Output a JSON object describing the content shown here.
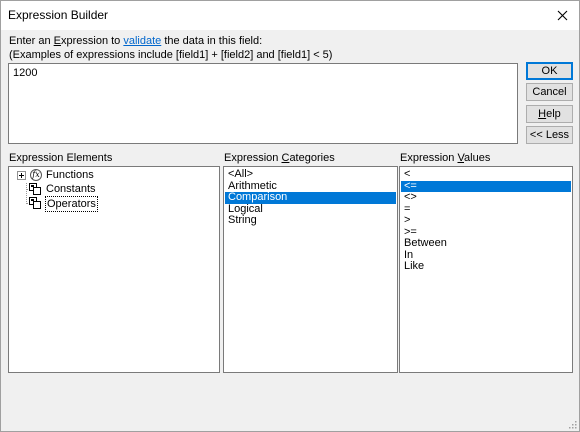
{
  "window": {
    "title": "Expression Builder"
  },
  "prompt": {
    "line1_before": "Enter an ",
    "line1_e": "E",
    "line1_mid": "xpression to ",
    "line1_link": "validate",
    "line1_after": " the data in this field:",
    "line2": "(Examples of expressions include [field1] + [field2] and [field1] < 5)"
  },
  "expression": {
    "value": "1200"
  },
  "buttons": {
    "ok": "OK",
    "cancel": "Cancel",
    "help_h": "H",
    "help_rest": "elp",
    "less": "<< Less"
  },
  "elements": {
    "label": "Expression Elements",
    "items": [
      "Functions",
      "Constants",
      "Operators"
    ]
  },
  "categories": {
    "label_before": "Expression ",
    "label_c": "C",
    "label_after": "ategories",
    "items": [
      "<All>",
      "Arithmetic",
      "Comparison",
      "Logical",
      "String"
    ],
    "selected": "Comparison"
  },
  "values": {
    "label_before": "Expression ",
    "label_v": "V",
    "label_after": "alues",
    "items": [
      "<",
      "<=",
      "<>",
      "=",
      ">",
      ">=",
      "Between",
      "In",
      "Like"
    ],
    "selected": "<="
  }
}
